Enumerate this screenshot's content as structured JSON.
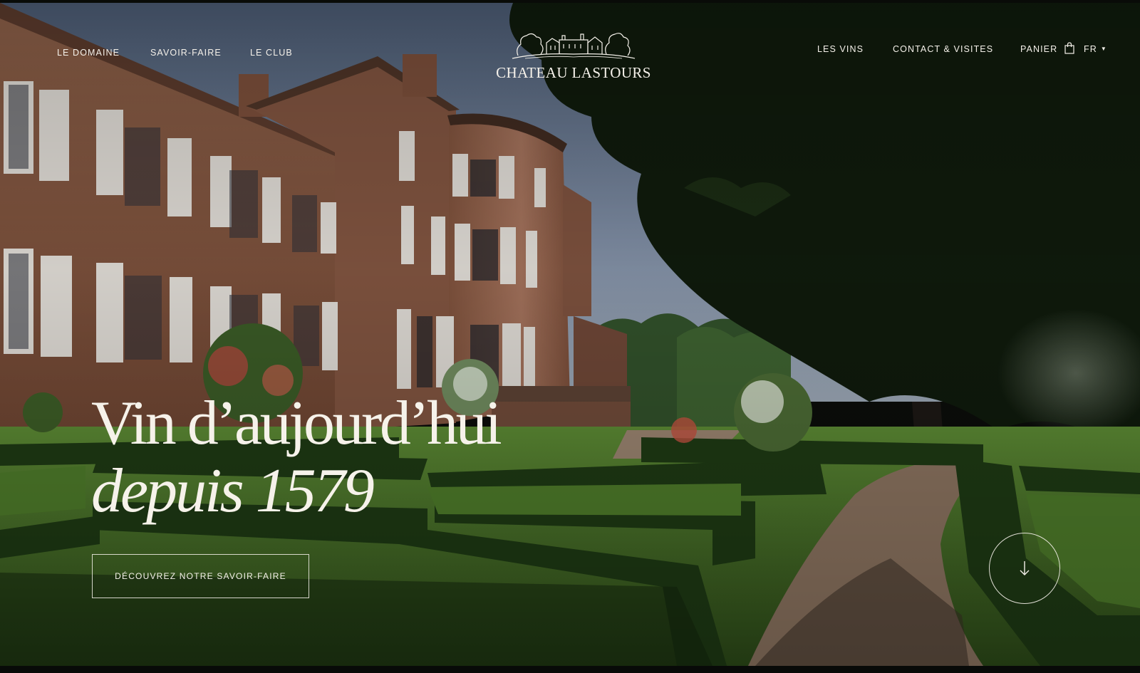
{
  "site": {
    "logo_text": "CHATEAU LASTOURS"
  },
  "nav": {
    "left": [
      {
        "label": "LE DOMAINE"
      },
      {
        "label": "SAVOIR-FAIRE"
      },
      {
        "label": "LE CLUB"
      }
    ],
    "right": [
      {
        "label": "LES VINS"
      },
      {
        "label": "CONTACT & VISITES"
      }
    ],
    "cart_label": "PANIER",
    "language": "FR"
  },
  "hero": {
    "headline_line1": "Vin d’aujourd’hui",
    "headline_line2": "depuis 1579",
    "cta_label": "DÉCOUVREZ NOTRE SAVOIR-FAIRE"
  },
  "icons": {
    "cart": "shopping-bag-icon",
    "language_caret": "caret-down-icon",
    "scroll": "arrow-down-icon",
    "logo": "chateau-emblem-icon"
  },
  "colors": {
    "text": "#f5f1ea",
    "sky": "#6f7f96",
    "brick": "#8a5a43",
    "lawn": "#4f7a2b",
    "hedge": "#1f3a14",
    "foliage": "#0f1a0c",
    "path": "#8c7460"
  }
}
